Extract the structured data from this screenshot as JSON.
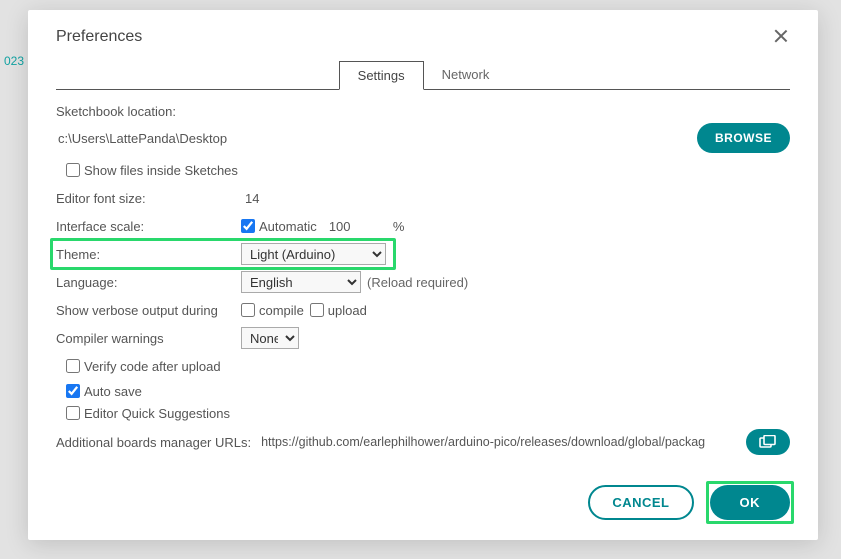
{
  "bg_fragment": "023",
  "dialog": {
    "title": "Preferences",
    "tabs": {
      "active": "Settings",
      "other": "Network"
    }
  },
  "settings": {
    "sketchbook_label": "Sketchbook location:",
    "sketchbook_path": "c:\\Users\\LattePanda\\Desktop",
    "browse_btn": "BROWSE",
    "show_files_label": "Show files inside Sketches",
    "show_files_checked": false,
    "font_size_label": "Editor font size:",
    "font_size_value": "14",
    "iface_scale_label": "Interface scale:",
    "iface_auto_label": "Automatic",
    "iface_auto_checked": true,
    "iface_scale_value": "100",
    "iface_pct": "%",
    "theme_label": "Theme:",
    "theme_value": "Light (Arduino)",
    "language_label": "Language:",
    "language_value": "English",
    "reload_note": "(Reload required)",
    "verbose_label": "Show verbose output during",
    "verbose_compile_label": "compile",
    "verbose_compile_checked": false,
    "verbose_upload_label": "upload",
    "verbose_upload_checked": false,
    "compiler_warnings_label": "Compiler warnings",
    "compiler_warnings_value": "None",
    "verify_label": "Verify code after upload",
    "verify_checked": false,
    "autosave_label": "Auto save",
    "autosave_checked": true,
    "quick_label": "Editor Quick Suggestions",
    "quick_checked": false,
    "urls_label": "Additional boards manager URLs:",
    "urls_value": "https://github.com/earlephilhower/arduino-pico/releases/download/global/packag"
  },
  "footer": {
    "cancel": "CANCEL",
    "ok": "OK"
  }
}
